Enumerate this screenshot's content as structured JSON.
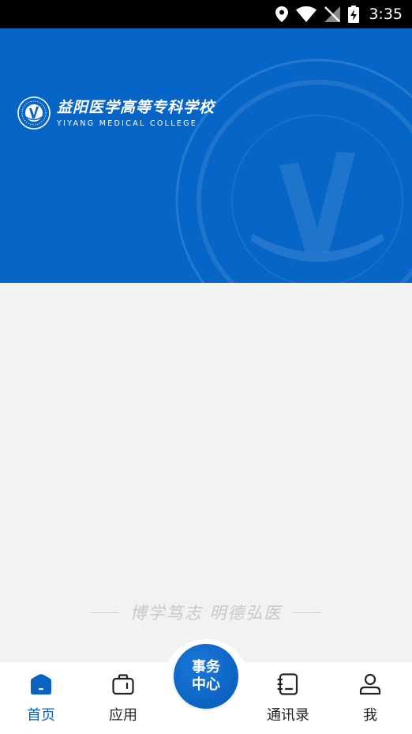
{
  "status_bar": {
    "time": "3:35"
  },
  "banner": {
    "school_name_cn": "益阳医学高等专科学校",
    "school_name_en": "YIYANG MEDICAL COLLEGE"
  },
  "motto": {
    "text": "博学笃志  明德弘医"
  },
  "tabbar": {
    "tabs": [
      {
        "label": "首页",
        "icon": "home-icon"
      },
      {
        "label": "应用",
        "icon": "briefcase-icon"
      },
      {
        "label": "事务中心",
        "line1": "事务",
        "line2": "中心"
      },
      {
        "label": "通讯录",
        "icon": "contacts-book-icon"
      },
      {
        "label": "我",
        "icon": "person-icon"
      }
    ]
  },
  "colors": {
    "accent": "#0a63c2",
    "banner": "#0665c6",
    "background": "#f2f2f2"
  }
}
